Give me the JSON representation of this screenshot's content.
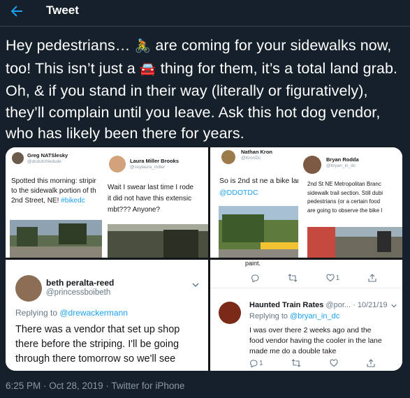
{
  "header": {
    "title": "Tweet"
  },
  "tweet": {
    "text_1": "Hey pedestrians… ",
    "emoji_1": "🚴",
    "text_2": " are coming for your sidewalks now, too! This isn’t just a ",
    "emoji_2": "🚘",
    "text_3": " thing for them, it’s a total land grab. Oh, & if you stand in their way (literally or figuratively), they’ll complain until you leave. Ask this hot dog vendor, who has likely been there for years."
  },
  "media": {
    "panel_a": {
      "name": "Greg NATSlesky",
      "handle": "@dcdutchiedude",
      "line_1": "Spotted this morning: stripir",
      "line_2": "to the sidewalk portion of th",
      "line_3_text": "2nd Street, NE! ",
      "line_3_link": "#bikedc"
    },
    "panel_b": {
      "name": "Laura Miller Brooks",
      "handle": "@soylaura_miller",
      "line_1": "Wait I swear last time I rode",
      "line_2": "it did not have this extensic",
      "line_3": "mbt??? Anyone?"
    },
    "panel_c": {
      "name": "Nathan Kron",
      "handle": "@KronDc",
      "line_1": "So is 2nd st ne a bike lane",
      "line_2_link": "@DDOTDC"
    },
    "panel_d": {
      "name": "Bryan Rodda",
      "handle": "@bryan_in_dc",
      "line_1": "2nd St NE Metropolitan Branc",
      "line_2": "sidewalk trail section. Still dubi",
      "line_3": "pedestrians (or a certain food",
      "line_4": "are going to observe the bike l"
    },
    "panel_e": {
      "name": "beth peralta-reed",
      "handle": "@princessboibeth",
      "replying_label": "Replying to ",
      "replying_to": "@drewackermann",
      "line_1": "There was a vendor that set up shop",
      "line_2": "there before the striping. I'll be going",
      "line_3": "through there tomorrow so we'll see"
    },
    "panel_f": {
      "top_text": "paint.",
      "top_like_count": "1",
      "name": "Haunted Train Rates",
      "handle": "@por... · 10/21/19",
      "replying_label": "Replying to ",
      "replying_to": "@bryan_in_dc",
      "line_1": "I was over there 2 weeks ago and the",
      "line_2": "food vendor having the cooler in the lane",
      "line_3": "made me do a double take",
      "reply_count": "1"
    }
  },
  "footer": {
    "meta": "6:25 PM · Oct 28, 2019 · Twitter for iPhone"
  },
  "colors": {
    "background": "#15202b",
    "accent": "#1da1f2",
    "muted": "#8899a6"
  }
}
